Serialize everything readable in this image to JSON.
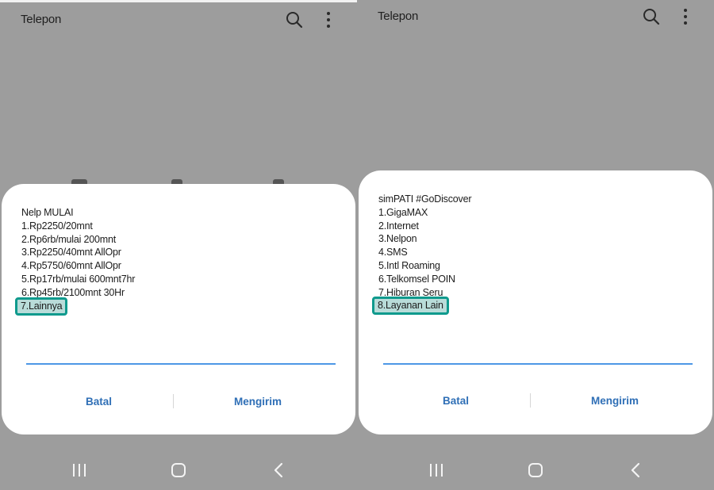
{
  "left": {
    "app_title": "Telepon",
    "ussd_lines": [
      "Nelp MULAI",
      "1.Rp2250/20mnt",
      "2.Rp6rb/mulai 200mnt",
      "3.Rp2250/40mnt AllOpr",
      "4.Rp5750/60mnt AllOpr",
      "5.Rp17rb/mulai 600mnt7hr",
      "6.Rp45rb/2100mnt 30Hr"
    ],
    "highlighted_option": "7.Lainnya",
    "cancel_label": "Batal",
    "send_label": "Mengirim"
  },
  "right": {
    "app_title": "Telepon",
    "ussd_lines": [
      "simPATI #GoDiscover",
      "1.GigaMAX",
      "2.Internet",
      "3.Nelpon",
      "4.SMS",
      "5.Intl Roaming",
      "6.Telkomsel POIN",
      "7.Hiburan Seru"
    ],
    "highlighted_option": "8.Layanan Lain",
    "cancel_label": "Batal",
    "send_label": "Mengirim"
  },
  "colors": {
    "accent": "#2f6fb6",
    "input_underline": "#4d97e6",
    "highlight_border": "#0f9a8d",
    "highlight_fill": "#b9dcd9",
    "scrim": "#9d9d9d"
  },
  "icons": [
    "search-icon",
    "more-vert-icon",
    "recents-icon",
    "home-icon",
    "back-icon"
  ]
}
